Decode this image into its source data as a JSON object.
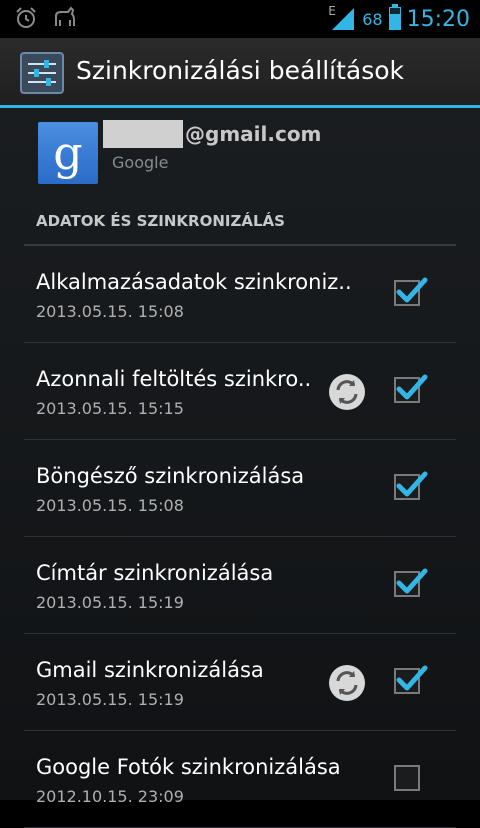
{
  "statusbar": {
    "time": "15:20",
    "battery_pct": "68",
    "network_type": "E",
    "left_icons": [
      "alarm-icon",
      "android-debug-icon"
    ]
  },
  "actionbar": {
    "title": "Szinkronizálási beállítások",
    "icon": "settings-sliders-icon"
  },
  "account": {
    "email": "@gmail.com",
    "provider": "Google",
    "logo_letter": "g",
    "logo_color": "#3b7dd8"
  },
  "section_header": "ADATOK ÉS SZINKRONIZÁLÁS",
  "items": [
    {
      "title": "Alkalmazásadatok szinkroniz..",
      "date": "2013.05.15. 15:08",
      "checked": true,
      "syncing": false
    },
    {
      "title": "Azonnali feltöltés szinkro..",
      "date": "2013.05.15. 15:15",
      "checked": true,
      "syncing": true
    },
    {
      "title": "Böngésző szinkronizálása",
      "date": "2013.05.15. 15:08",
      "checked": true,
      "syncing": false
    },
    {
      "title": "Címtár szinkronizálása",
      "date": "2013.05.15. 15:19",
      "checked": true,
      "syncing": false
    },
    {
      "title": "Gmail szinkronizálása",
      "date": "2013.05.15. 15:19",
      "checked": true,
      "syncing": true
    },
    {
      "title": "Google Fotók szinkronizálása",
      "date": "2012.10.15. 23:09",
      "checked": false,
      "syncing": false
    }
  ],
  "colors": {
    "accent": "#33b5e5",
    "check": "#33b5e5"
  }
}
